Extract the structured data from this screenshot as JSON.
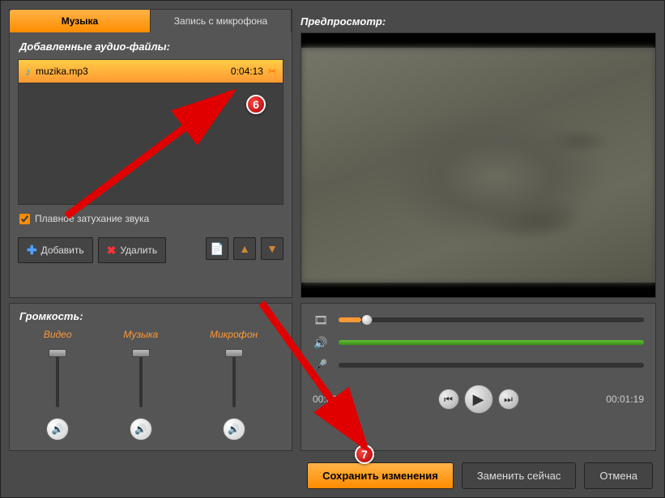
{
  "tabs": {
    "music": "Музыка",
    "mic": "Запись с микрофона"
  },
  "files": {
    "title": "Добавленные аудио-файлы:",
    "item": {
      "name": "muzika.mp3",
      "duration": "0:04:13"
    },
    "fade": "Плавное затухание звука"
  },
  "toolbar": {
    "add": "Добавить",
    "del": "Удалить"
  },
  "preview": {
    "title": "Предпросмотр:"
  },
  "volume": {
    "title": "Громкость:",
    "video": "Видео",
    "music": "Музыка",
    "mic": "Микрофон"
  },
  "timeline": {
    "current": "00:00:05",
    "total": "00:01:19"
  },
  "actions": {
    "save": "Сохранить изменения",
    "replace": "Заменить сейчас",
    "cancel": "Отмена"
  },
  "annotations": {
    "n6": "6",
    "n7": "7"
  }
}
